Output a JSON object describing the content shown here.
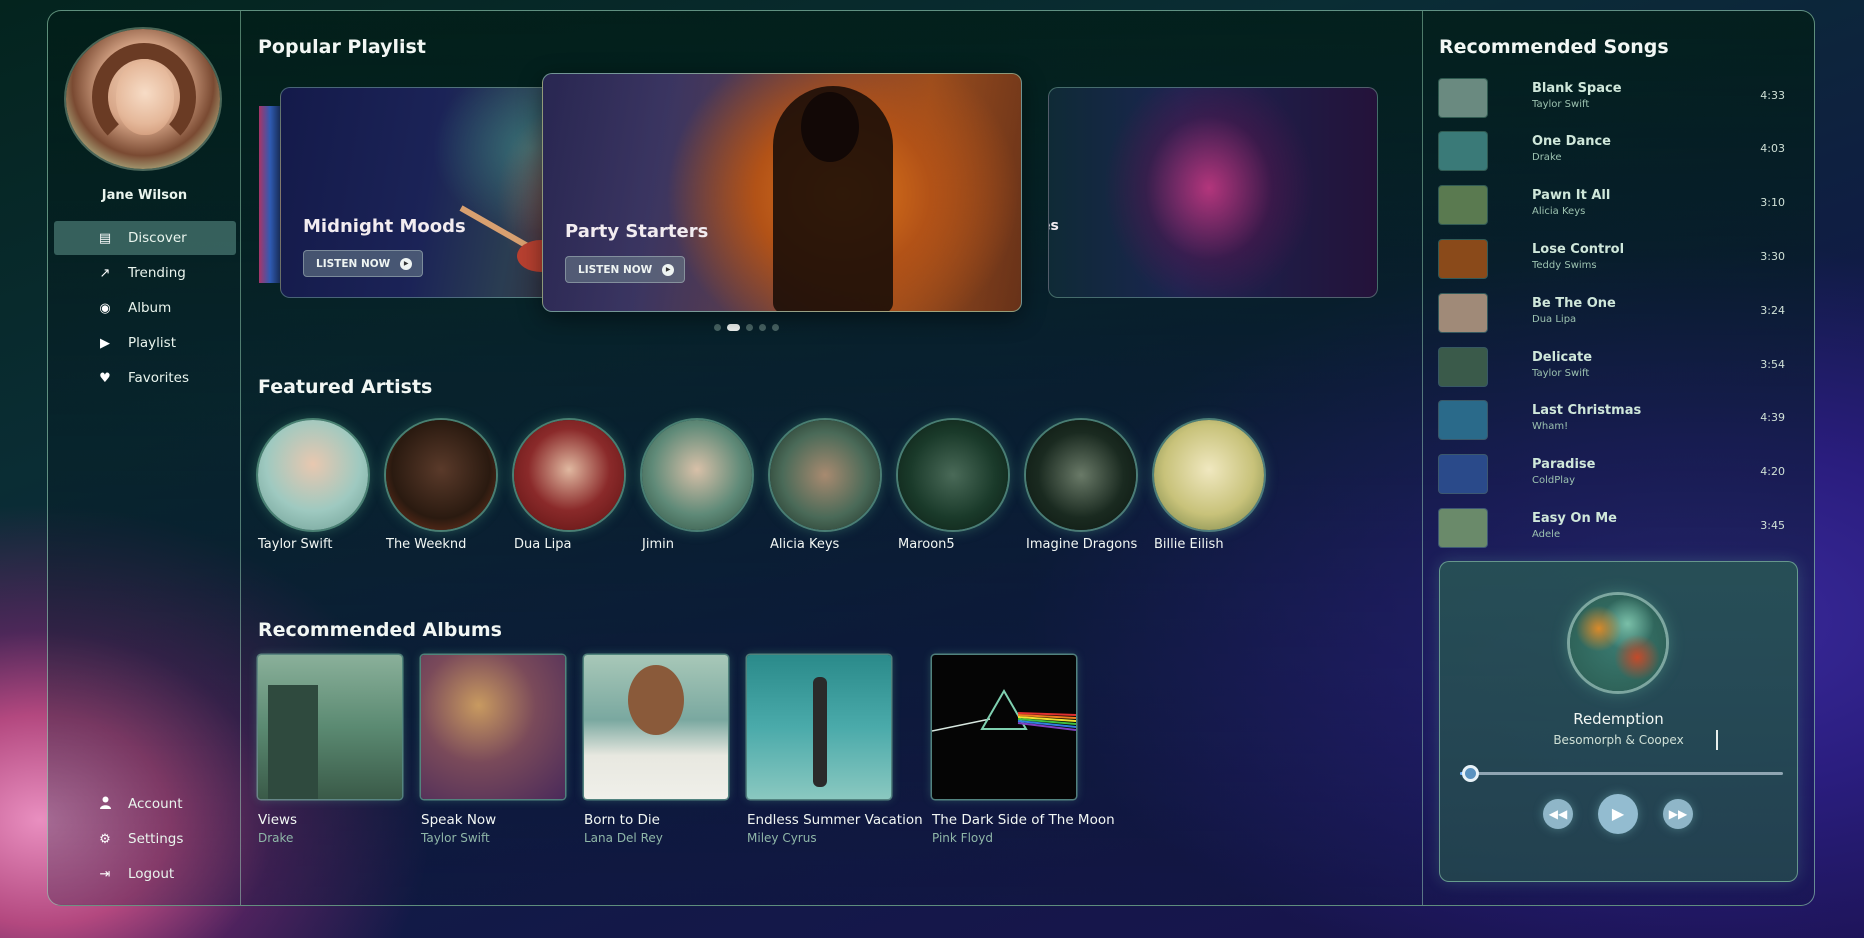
{
  "user": {
    "name": "Jane Wilson"
  },
  "nav": {
    "items": [
      {
        "label": "Discover",
        "icon": "map-icon",
        "glyph": "▤",
        "active": true
      },
      {
        "label": "Trending",
        "icon": "trending-icon",
        "glyph": "↗",
        "active": false
      },
      {
        "label": "Album",
        "icon": "disc-icon",
        "glyph": "◉",
        "active": false
      },
      {
        "label": "Playlist",
        "icon": "play-circle-icon",
        "glyph": "▶",
        "active": false
      },
      {
        "label": "Favorites",
        "icon": "heart-icon",
        "glyph": "♥",
        "active": false
      }
    ],
    "bottom": [
      {
        "label": "Account",
        "icon": "user-icon",
        "glyph": "👤"
      },
      {
        "label": "Settings",
        "icon": "gear-icon",
        "glyph": "⚙"
      },
      {
        "label": "Logout",
        "icon": "logout-icon",
        "glyph": "⇥"
      }
    ]
  },
  "popular": {
    "title": "Popular Playlist",
    "cards": [
      {
        "title": "Midnight Moods",
        "button": "LISTEN NOW"
      },
      {
        "title": "Party Starters",
        "button": "LISTEN NOW"
      },
      {
        "title": "es"
      }
    ],
    "dots": 5,
    "active_dot": 1
  },
  "artists": {
    "title": "Featured Artists",
    "items": [
      {
        "name": "Taylor Swift",
        "color": "#9ec9c0"
      },
      {
        "name": "The Weeknd",
        "color": "#2a1a10"
      },
      {
        "name": "Dua Lipa",
        "color": "#7a1a1a"
      },
      {
        "name": "Jimin",
        "color": "#5f8a78"
      },
      {
        "name": "Alicia Keys",
        "color": "#4a6a58"
      },
      {
        "name": "Maroon5",
        "color": "#1a3a2a"
      },
      {
        "name": "Imagine Dragons",
        "color": "#1a2a20"
      },
      {
        "name": "Billie Eilish",
        "color": "#c8c27a"
      }
    ]
  },
  "albums": {
    "title": "Recommended Albums",
    "items": [
      {
        "title": "Views",
        "artist": "Drake",
        "color": "#5b8a72"
      },
      {
        "title": "Speak Now",
        "artist": "Taylor Swift",
        "color": "#5a3a6a"
      },
      {
        "title": "Born to Die",
        "artist": "Lana Del Rey",
        "color": "#7aa8a0"
      },
      {
        "title": "Endless Summer Vacation",
        "artist": "Miley Cyrus",
        "color": "#3a9a9a"
      },
      {
        "title": "The Dark Side of The Moon",
        "artist": "Pink Floyd",
        "color": "#050505"
      }
    ]
  },
  "songs": {
    "title": "Recommended Songs",
    "items": [
      {
        "title": "Blank Space",
        "artist": "Taylor Swift",
        "duration": "4:33",
        "color": "#6a8a80"
      },
      {
        "title": "One Dance",
        "artist": "Drake",
        "duration": "4:03",
        "color": "#3a7a78"
      },
      {
        "title": "Pawn It All",
        "artist": "Alicia Keys",
        "duration": "3:10",
        "color": "#5a7a50"
      },
      {
        "title": "Lose Control",
        "artist": "Teddy Swims",
        "duration": "3:30",
        "color": "#8a4a1a"
      },
      {
        "title": "Be The One",
        "artist": "Dua Lipa",
        "duration": "3:24",
        "color": "#a08a78"
      },
      {
        "title": "Delicate",
        "artist": "Taylor Swift",
        "duration": "3:54",
        "color": "#3a5a4a"
      },
      {
        "title": "Last Christmas",
        "artist": "Wham!",
        "duration": "4:39",
        "color": "#2a6a8a"
      },
      {
        "title": "Paradise",
        "artist": "ColdPlay",
        "duration": "4:20",
        "color": "#2a4a8a"
      },
      {
        "title": "Easy On Me",
        "artist": "Adele",
        "duration": "3:45",
        "color": "#6a8a6a"
      }
    ]
  },
  "player": {
    "title": "Redemption",
    "artist": "Besomorph & Coopex",
    "progress": 0.03
  }
}
